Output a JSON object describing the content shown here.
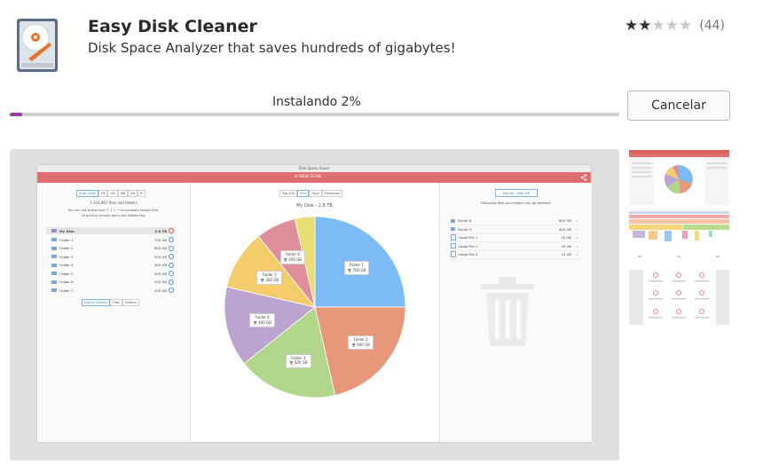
{
  "app": {
    "title": "Easy Disk Cleaner",
    "subtitle": "Disk Space Analyzer that saves hundreds of gigabytes!",
    "rating_stars": 2,
    "rating_max": 5,
    "rating_count": "(44)"
  },
  "install": {
    "status": "Instalando 2%",
    "progress": 0.02,
    "cancel_label": "Cancelar",
    "accent": "#953e9b"
  },
  "preview": {
    "window_title": "Disk Space Saver",
    "new_scan": "NEW SCAN",
    "left": {
      "units": [
        "Auto Sizes",
        "TB",
        "GB",
        "MB",
        "KB",
        "B"
      ],
      "count": "1 324 867 files and folders",
      "hint1": "You can use arrow keys ↑ ↓ ← → to navigate trough tree.",
      "hint2": "To quickly remove item click Delete key.",
      "root": {
        "name": "My Disk",
        "size": "2.8 TB"
      },
      "items": [
        {
          "name": "Folder 1",
          "size": "700 GB"
        },
        {
          "name": "Folder 2",
          "size": "600 GB"
        },
        {
          "name": "Folder 3",
          "size": "500 GB"
        },
        {
          "name": "Folder 4",
          "size": "400 GB"
        },
        {
          "name": "Folder 5",
          "size": "300 GB"
        },
        {
          "name": "Folder 6",
          "size": "200 GB"
        },
        {
          "name": "Folder 7",
          "size": "100 GB"
        }
      ],
      "filters": [
        "Files & Folders",
        "Files",
        "Folders"
      ]
    },
    "center": {
      "tabs": [
        "Top 100",
        "Size",
        "Type",
        "Extension"
      ],
      "chart_title": "My Disk - 2.8 TB"
    },
    "right": {
      "delete_label": "Delete : 860 GB",
      "note": "Following files and folders will be deleted:",
      "items": [
        {
          "name": "Folder 8",
          "size": "800 GB",
          "kind": "folder"
        },
        {
          "name": "Folder 9",
          "size": "400 GB",
          "kind": "folder"
        },
        {
          "name": "Large File 1",
          "size": "20 GB",
          "kind": "file"
        },
        {
          "name": "Large File 2",
          "size": "30 GB",
          "kind": "file"
        },
        {
          "name": "Large File 3",
          "size": "10 GB",
          "kind": "file"
        }
      ]
    }
  },
  "chart_data": {
    "type": "pie",
    "title": "My Disk - 2.8 TB",
    "categories": [
      "Folder 1",
      "Folder 2",
      "Folder 3",
      "Folder 4",
      "Folder 5",
      "Folder 6",
      "Folder 7"
    ],
    "values": [
      700,
      600,
      500,
      400,
      300,
      200,
      100
    ],
    "value_labels": [
      "700 GB",
      "600 GB",
      "500 GB",
      "400 GB",
      "300 GB",
      "200 GB",
      "100 GB"
    ],
    "colors": [
      "#7dbbf7",
      "#e8987a",
      "#b2d68b",
      "#bda3cf",
      "#f5cc6c",
      "#de8f9b",
      "#e8de75"
    ]
  },
  "icons": {
    "app": "hard-disk-icon",
    "share": "share-icon",
    "trash": "trash-icon",
    "new_scan": "refresh-icon"
  }
}
